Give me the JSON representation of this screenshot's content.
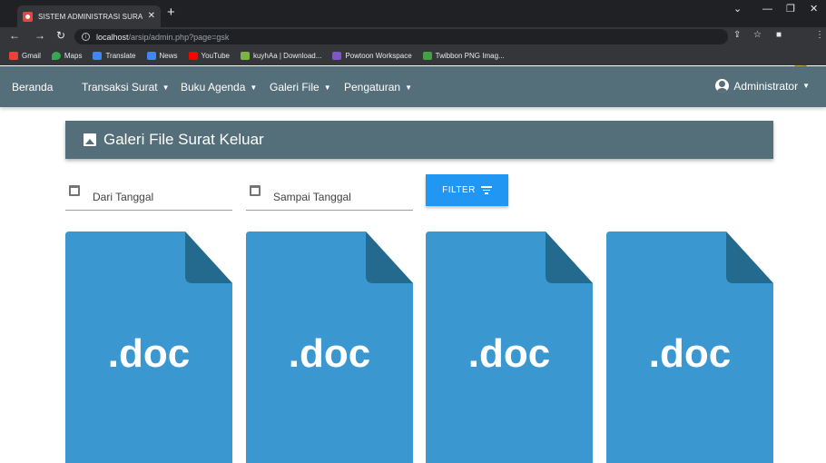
{
  "browser": {
    "tab_title": "SISTEM ADMINISTRASI SURAT T",
    "url_host": "localhost",
    "url_path": "/arsip/admin.php?page=gsk",
    "bookmarks": [
      {
        "label": "Gmail",
        "color": "#ea4335"
      },
      {
        "label": "Maps",
        "color": "#34a853"
      },
      {
        "label": "Translate",
        "color": "#4285f4"
      },
      {
        "label": "News",
        "color": "#4285f4"
      },
      {
        "label": "YouTube",
        "color": "#ff0000"
      },
      {
        "label": "kuyhAa | Download...",
        "color": "#7cb342"
      },
      {
        "label": "Powtoon Workspace",
        "color": "#7e57c2"
      },
      {
        "label": "Twibbon PNG Imag...",
        "color": "#43a047"
      }
    ]
  },
  "nav": {
    "home": "Beranda",
    "menus": [
      {
        "label": "Transaksi Surat"
      },
      {
        "label": "Buku Agenda"
      },
      {
        "label": "Galeri File"
      },
      {
        "label": "Pengaturan"
      }
    ],
    "user": "Administrator"
  },
  "header": {
    "title": "Galeri File Surat Keluar",
    "icon": "image-icon"
  },
  "filter": {
    "from_placeholder": "Dari Tanggal",
    "to_placeholder": "Sampai Tanggal",
    "button_label": "FILTER"
  },
  "files": [
    {
      "ext": ".doc"
    },
    {
      "ext": ".doc"
    },
    {
      "ext": ".doc"
    },
    {
      "ext": ".doc"
    }
  ],
  "colors": {
    "navbar": "#546e7a",
    "primary": "#2196f3",
    "doc_body": "#3a97d0",
    "doc_fold": "#246a8f"
  }
}
